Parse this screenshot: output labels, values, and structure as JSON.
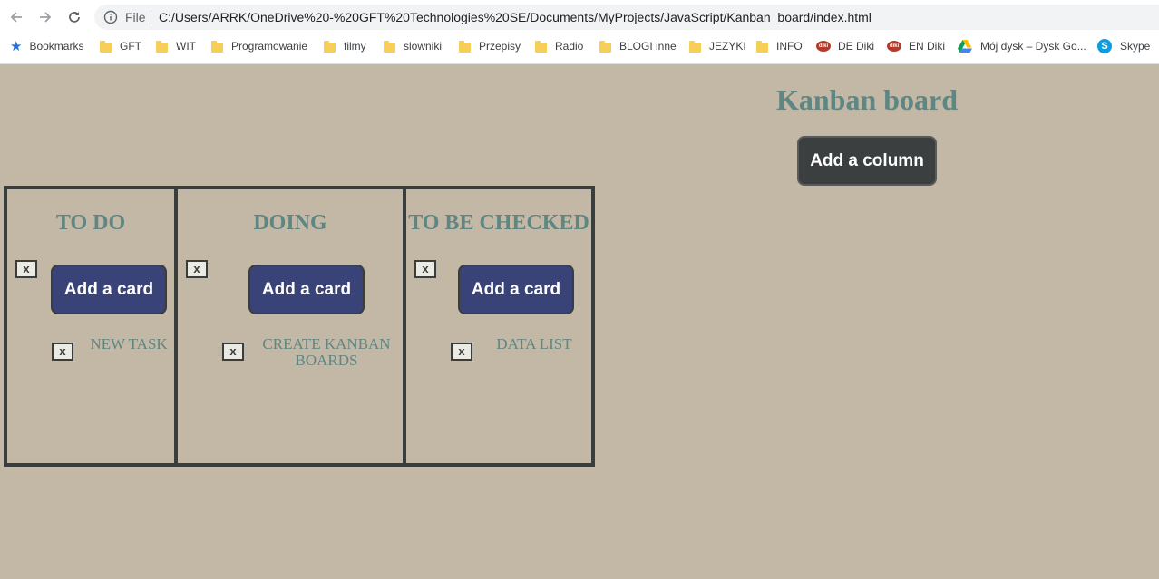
{
  "browser": {
    "file_label": "File",
    "url": "C:/Users/ARRK/OneDrive%20-%20GFT%20Technologies%20SE/Documents/MyProjects/JavaScript/Kanban_board/index.html",
    "bookmarks": [
      "Bookmarks",
      "GFT",
      "WIT",
      "Programowanie",
      "filmy",
      "slowniki",
      "Przepisy",
      "Radio",
      "BLOGI inne",
      "JEZYKI",
      "INFO",
      "DE Diki",
      "EN Diki",
      "Mój dysk – Dysk Go...",
      "Skype"
    ]
  },
  "page": {
    "title": "Kanban board",
    "add_column_label": "Add a column"
  },
  "columns": [
    {
      "title": "TO DO",
      "delete_label": "x",
      "add_card_label": "Add a card",
      "cards": [
        {
          "delete_label": "x",
          "text": "NEW TASK"
        }
      ]
    },
    {
      "title": "DOING",
      "delete_label": "x",
      "add_card_label": "Add a card",
      "cards": [
        {
          "delete_label": "x",
          "text": "CREATE KANBAN BOARDS"
        }
      ]
    },
    {
      "title": "TO BE CHECKED",
      "delete_label": "x",
      "add_card_label": "Add a card",
      "cards": [
        {
          "delete_label": "x",
          "text": "DATA LIST"
        }
      ]
    }
  ]
}
